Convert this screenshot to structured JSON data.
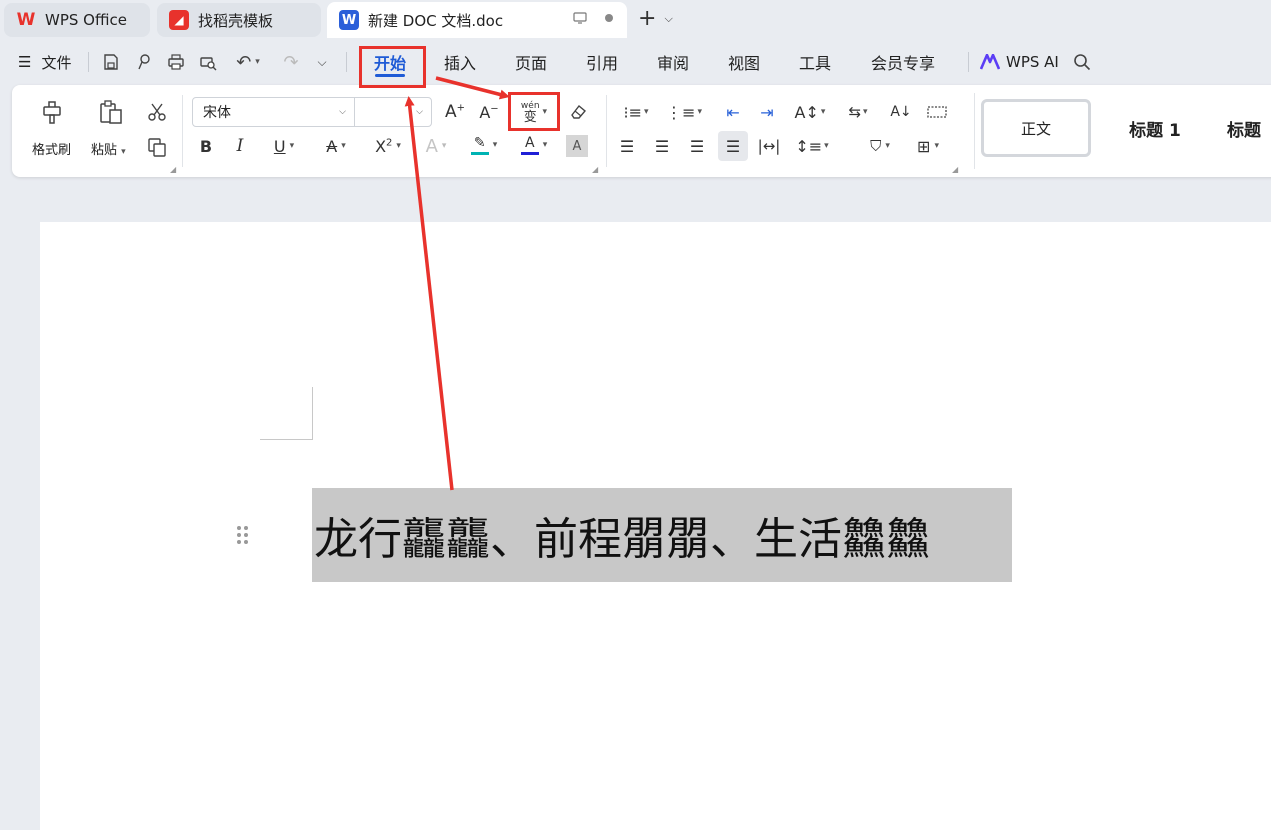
{
  "tabs": [
    {
      "label": "WPS Office"
    },
    {
      "label": "找稻壳模板"
    },
    {
      "label": "新建 DOC 文档.doc"
    }
  ],
  "menu": {
    "file": "文件",
    "tabs": [
      "开始",
      "插入",
      "页面",
      "引用",
      "审阅",
      "视图",
      "工具",
      "会员专享"
    ],
    "active_tab": "开始",
    "wps_ai": "WPS AI"
  },
  "ribbon": {
    "format_painter": "格式刷",
    "paste": "粘贴",
    "font_name": "宋体",
    "font_size": "",
    "phonetic_icon_text": "拼音",
    "styles": [
      "正文",
      "标题 1",
      "标题"
    ]
  },
  "document": {
    "text": "龙行龘龘、前程朤朤、生活䲜䲜"
  },
  "colors": {
    "accent": "#1f5bd6",
    "annotation": "#e8322c",
    "highlight": "#00b3b3",
    "font_color": "#1f1fd6",
    "selection": "#c8c8c8"
  }
}
